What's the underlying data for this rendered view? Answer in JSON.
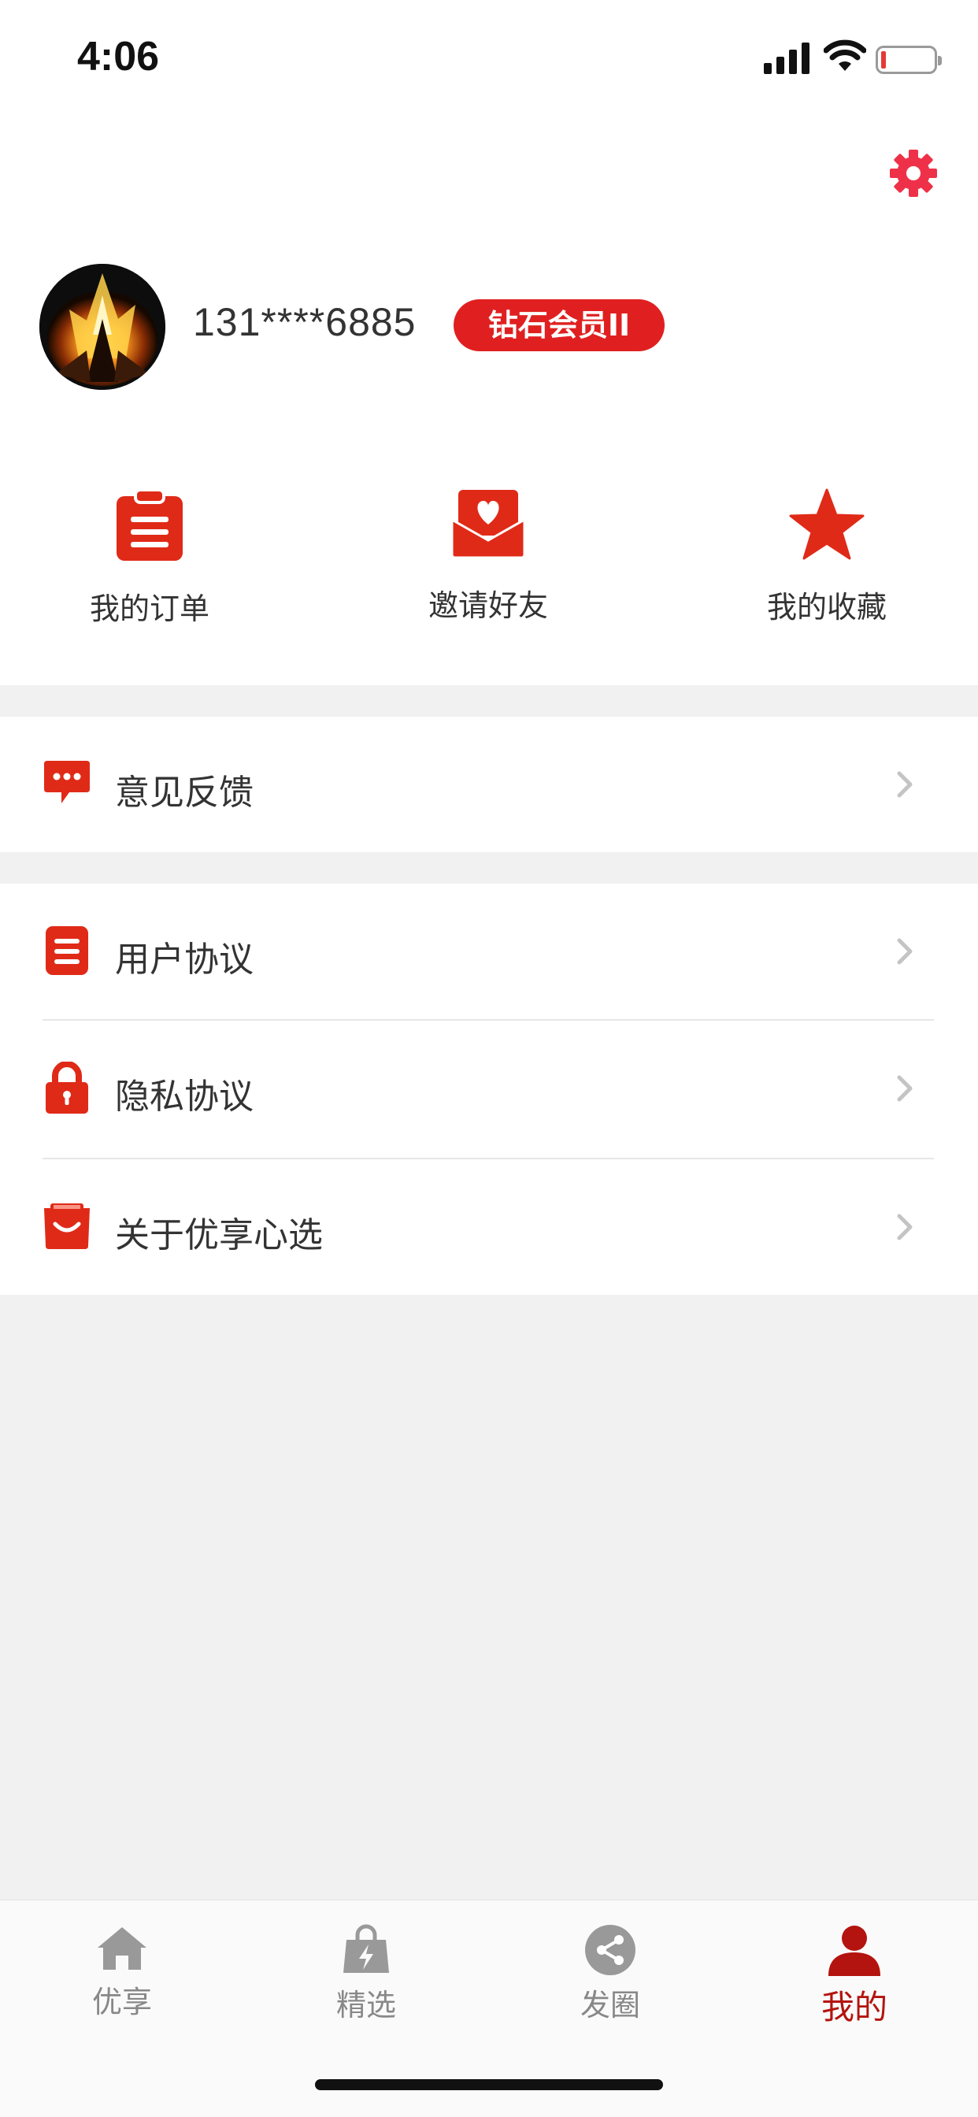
{
  "status_bar": {
    "time": "4:06",
    "battery_level": 0.1
  },
  "colors": {
    "accent": "#e02a18",
    "badge": "#e02020",
    "active_tab": "#b3140f",
    "settings_icon": "#ee3148"
  },
  "header": {
    "settings_icon": "gear-icon"
  },
  "profile": {
    "phone": "131****6885",
    "badge": "钻石会员II",
    "avatar_icon": "campfire-avatar"
  },
  "quick_actions": [
    {
      "label": "我的订单",
      "icon": "clipboard-icon"
    },
    {
      "label": "邀请好友",
      "icon": "envelope-heart-icon"
    },
    {
      "label": "我的收藏",
      "icon": "star-icon"
    }
  ],
  "menu": {
    "feedback": {
      "label": "意见反馈",
      "icon": "chat-bubble-icon"
    },
    "items": [
      {
        "label": "用户协议",
        "icon": "document-icon"
      },
      {
        "label": "隐私协议",
        "icon": "lock-icon"
      },
      {
        "label": "关于优享心选",
        "icon": "shopping-bag-icon"
      }
    ]
  },
  "tabbar": [
    {
      "label": "优享",
      "icon": "home-icon",
      "active": false
    },
    {
      "label": "精选",
      "icon": "bag-bolt-icon",
      "active": false
    },
    {
      "label": "发圈",
      "icon": "share-icon",
      "active": false
    },
    {
      "label": "我的",
      "icon": "person-icon",
      "active": true
    }
  ]
}
